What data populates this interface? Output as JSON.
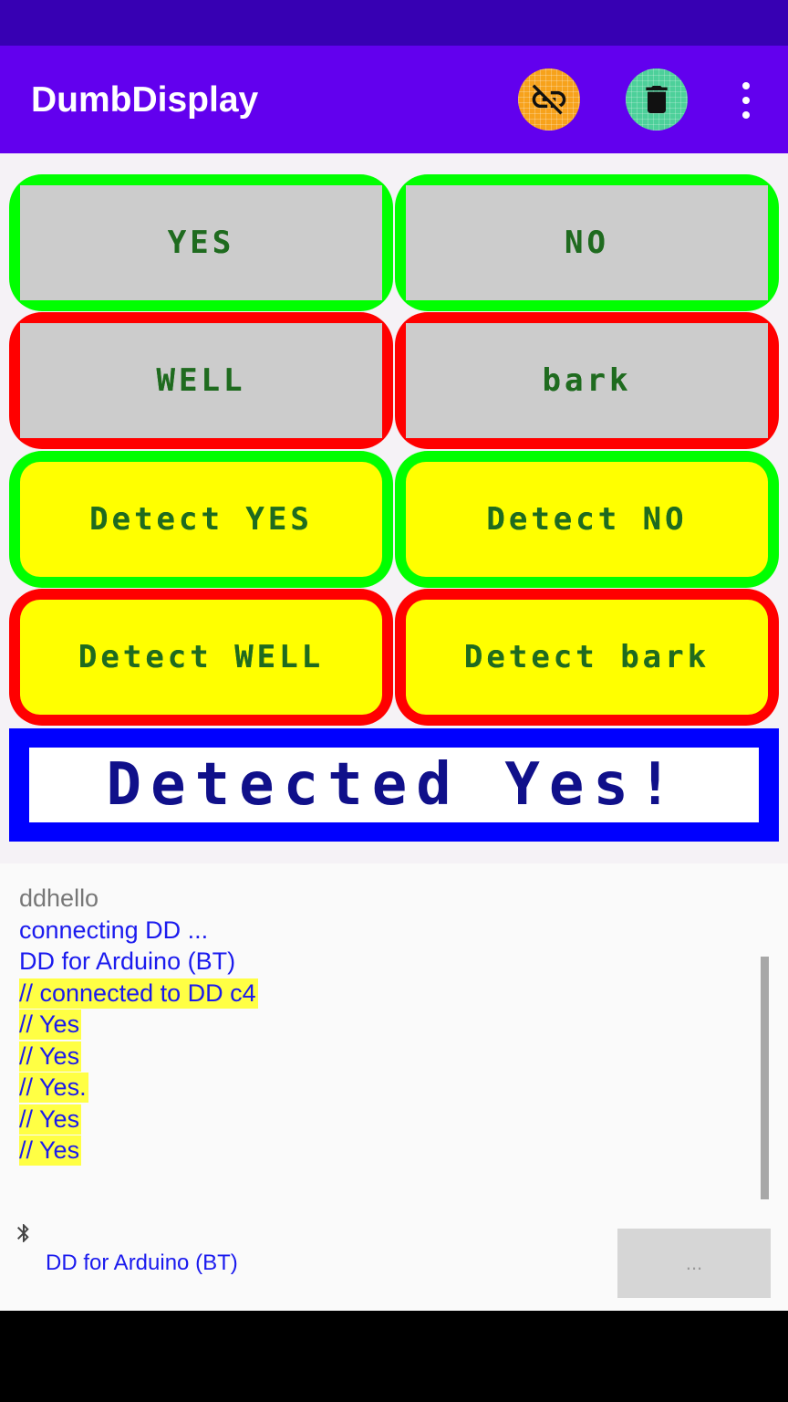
{
  "app": {
    "title": "DumbDisplay"
  },
  "toolbar": {
    "link_icon": "link-off-icon",
    "trash_icon": "trash-icon",
    "menu_icon": "more-vert-icon",
    "link_color": "#f7a21b",
    "trash_color": "#4dd09a"
  },
  "buttons": [
    {
      "label": "YES",
      "border": "#00ff00",
      "face": "#cccccc"
    },
    {
      "label": "NO",
      "border": "#00ff00",
      "face": "#cccccc"
    },
    {
      "label": "WELL",
      "border": "#ff0000",
      "face": "#cccccc"
    },
    {
      "label": "bark",
      "border": "#ff0000",
      "face": "#cccccc"
    },
    {
      "label": "Detect YES",
      "border": "#00ff00",
      "face": "#ffff00"
    },
    {
      "label": "Detect NO",
      "border": "#00ff00",
      "face": "#ffff00"
    },
    {
      "label": "Detect WELL",
      "border": "#ff0000",
      "face": "#ffff00"
    },
    {
      "label": "Detect bark",
      "border": "#ff0000",
      "face": "#ffff00"
    }
  ],
  "result": {
    "text": "Detected Yes!",
    "border": "#0000ff",
    "text_color": "#10108a"
  },
  "log": [
    {
      "text": "ddhello",
      "style": "grey"
    },
    {
      "text": "connecting DD ...",
      "style": "blue"
    },
    {
      "text": "DD for Arduino (BT)",
      "style": "blue"
    },
    {
      "text": "// connected to DD c4",
      "style": "highlight"
    },
    {
      "text": "// Yes",
      "style": "highlight"
    },
    {
      "text": "// Yes",
      "style": "highlight"
    },
    {
      "text": "// Yes.",
      "style": "highlight"
    },
    {
      "text": "// Yes",
      "style": "highlight"
    },
    {
      "text": "// Yes",
      "style": "highlight"
    }
  ],
  "footer": {
    "bluetooth_icon": "bluetooth-icon",
    "connection_label": "DD for Arduino (BT)",
    "more_button_label": "..."
  }
}
